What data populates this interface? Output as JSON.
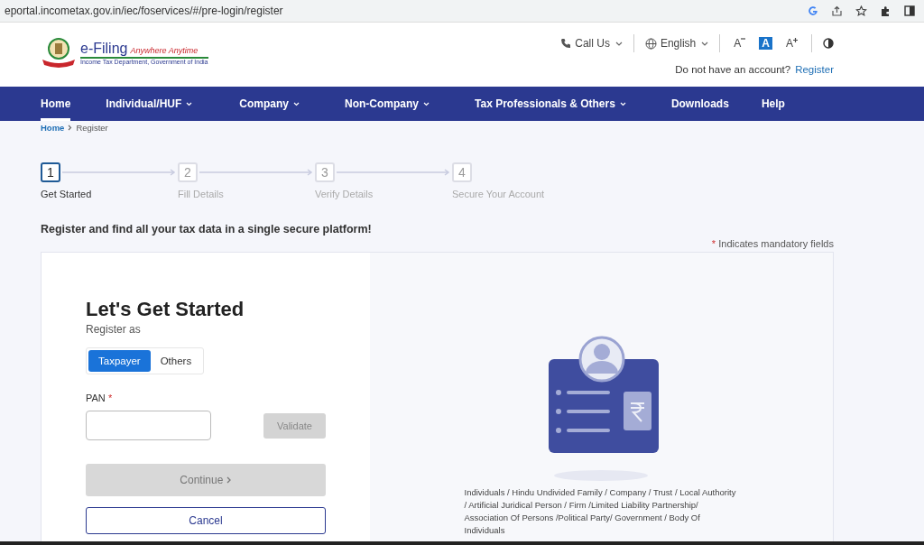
{
  "browser": {
    "url": "eportal.incometax.gov.in/iec/foservices/#/pre-login/register"
  },
  "header": {
    "logo_title": "e-Filing",
    "logo_tagline": "Anywhere Anytime",
    "logo_subtitle": "Income Tax Department, Government of India",
    "call_us": "Call Us",
    "language": "English",
    "font_controls": [
      {
        "label": "A",
        "kind": "decrease",
        "selected": false
      },
      {
        "label": "A",
        "kind": "normal",
        "selected": true
      },
      {
        "label": "A",
        "kind": "increase",
        "selected": false
      }
    ],
    "account_prompt": "Do not have an account?",
    "register_link": "Register"
  },
  "nav": [
    {
      "label": "Home",
      "has_menu": false,
      "selected": true
    },
    {
      "label": "Individual/HUF",
      "has_menu": true,
      "selected": false
    },
    {
      "label": "Company",
      "has_menu": true,
      "selected": false
    },
    {
      "label": "Non-Company",
      "has_menu": true,
      "selected": false
    },
    {
      "label": "Tax Professionals & Others",
      "has_menu": true,
      "selected": false
    },
    {
      "label": "Downloads",
      "has_menu": false,
      "selected": false
    },
    {
      "label": "Help",
      "has_menu": false,
      "selected": false
    }
  ],
  "breadcrumb": [
    "Home",
    "Register"
  ],
  "steps": [
    {
      "number": "1",
      "label": "Get Started",
      "selected": true
    },
    {
      "number": "2",
      "label": "Fill Details",
      "selected": false
    },
    {
      "number": "3",
      "label": "Verify Details",
      "selected": false
    },
    {
      "number": "4",
      "label": "Secure Your Account",
      "selected": false
    }
  ],
  "intro": "Register and find all your tax data in a single secure platform!",
  "mandatory_mark": "*",
  "mandatory_note": "Indicates mandatory fields",
  "form": {
    "title": "Let's Get Started",
    "subtitle": "Register as",
    "register_as": [
      {
        "label": "Taxpayer",
        "selected": true
      },
      {
        "label": "Others",
        "selected": false
      }
    ],
    "pan_label": "PAN",
    "pan_required_mark": "*",
    "validate": "Validate",
    "validate_disabled": true,
    "continue": "Continue",
    "continue_disabled": true,
    "cancel": "Cancel"
  },
  "illustration_caption": "Individuals / Hindu Undivided Family / Company / Trust / Local Authority / Artificial Juridical Person / Firm /Limited Liability Partnership/ Association Of Persons /Political Party/ Government / Body Of Individuals"
}
